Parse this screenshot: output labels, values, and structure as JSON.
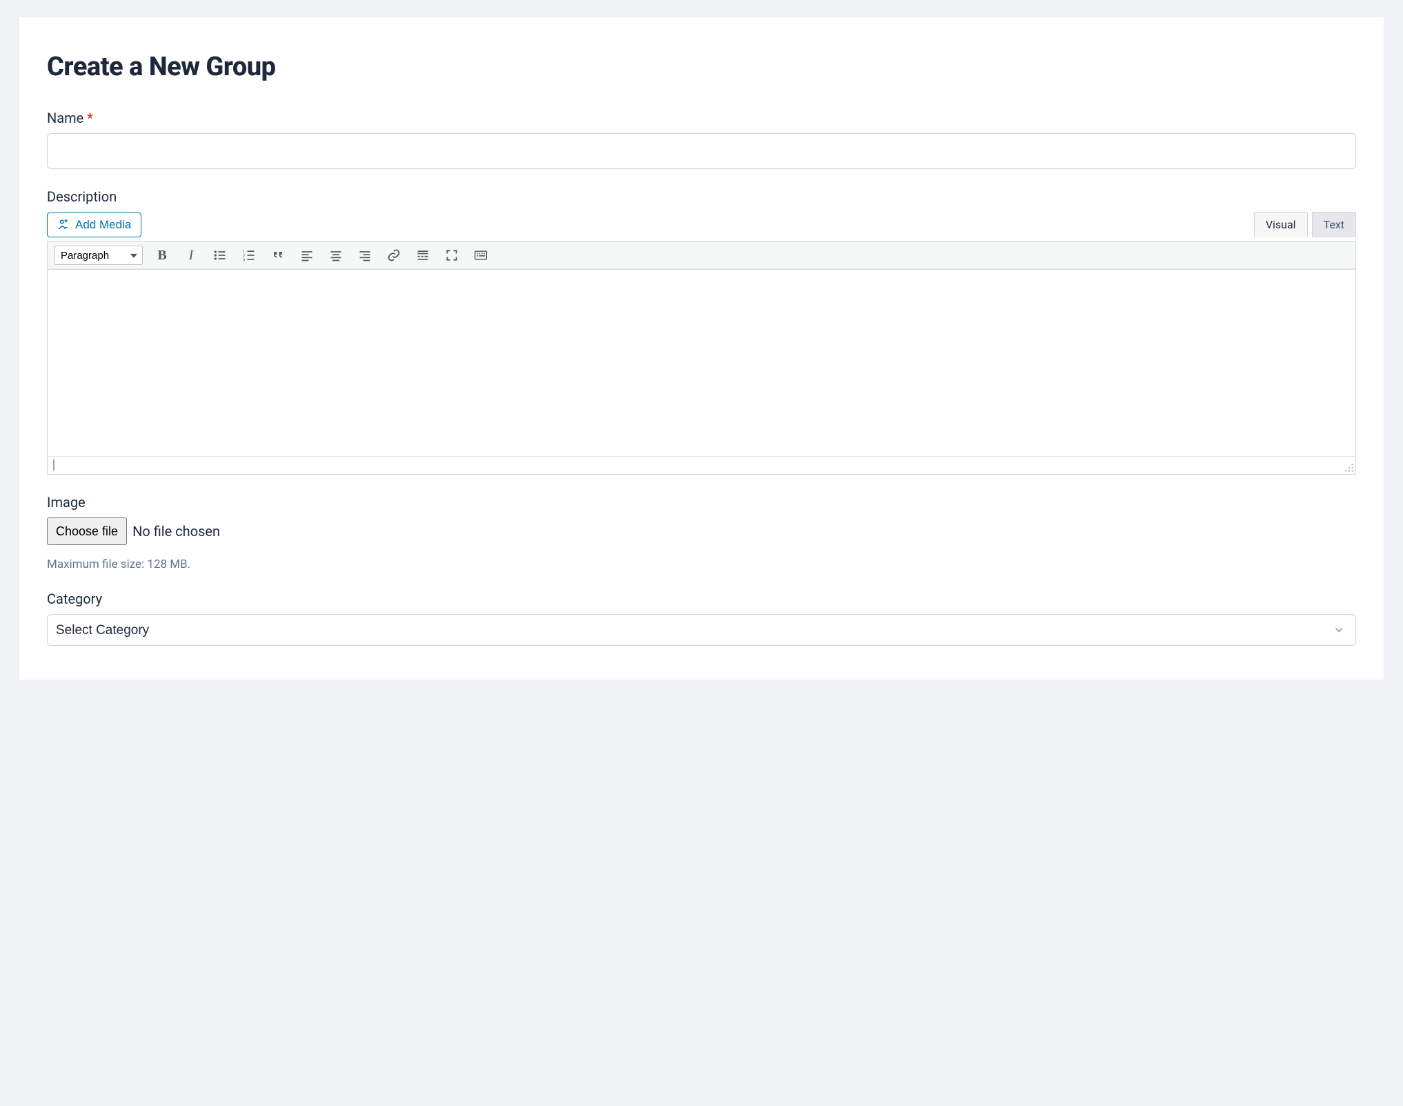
{
  "page": {
    "title": "Create a New Group"
  },
  "form": {
    "name": {
      "label": "Name",
      "required_marker": "*",
      "value": ""
    },
    "description": {
      "label": "Description",
      "add_media_label": "Add Media",
      "tabs": {
        "visual": "Visual",
        "text": "Text"
      },
      "format_select": "Paragraph",
      "content": ""
    },
    "image": {
      "label": "Image",
      "choose_button": "Choose file",
      "status": "No file chosen",
      "helper": "Maximum file size: 128 MB."
    },
    "category": {
      "label": "Category",
      "placeholder": "Select Category"
    }
  }
}
